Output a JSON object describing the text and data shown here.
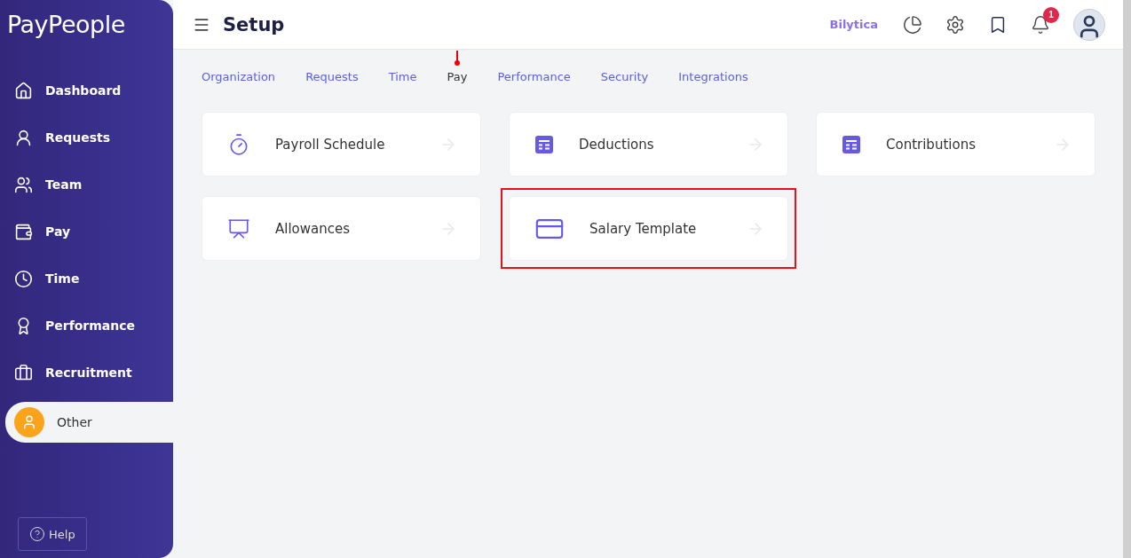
{
  "sidebar": {
    "logo": "PayPeople",
    "items": [
      {
        "label": "Dashboard",
        "selected": false
      },
      {
        "label": "Requests",
        "selected": false
      },
      {
        "label": "Team",
        "selected": false
      },
      {
        "label": "Pay",
        "selected": false
      },
      {
        "label": "Time",
        "selected": false
      },
      {
        "label": "Performance",
        "selected": false
      },
      {
        "label": "Recruitment",
        "selected": false
      },
      {
        "label": "Other",
        "selected": true
      }
    ],
    "help": "Help"
  },
  "header": {
    "title": "Setup",
    "company": "Bilytica",
    "notifications": "1"
  },
  "tabs": [
    {
      "label": "Organization",
      "selected": false
    },
    {
      "label": "Requests",
      "selected": false
    },
    {
      "label": "Time",
      "selected": false
    },
    {
      "label": "Pay",
      "selected": true
    },
    {
      "label": "Performance",
      "selected": false
    },
    {
      "label": "Security",
      "selected": false
    },
    {
      "label": "Integrations",
      "selected": false
    }
  ],
  "cards": [
    {
      "label": "Payroll Schedule",
      "highlighted": false
    },
    {
      "label": "Deductions",
      "highlighted": false
    },
    {
      "label": "Contributions",
      "highlighted": false
    },
    {
      "label": "Allowances",
      "highlighted": false
    },
    {
      "label": "Salary Template",
      "highlighted": true
    }
  ]
}
